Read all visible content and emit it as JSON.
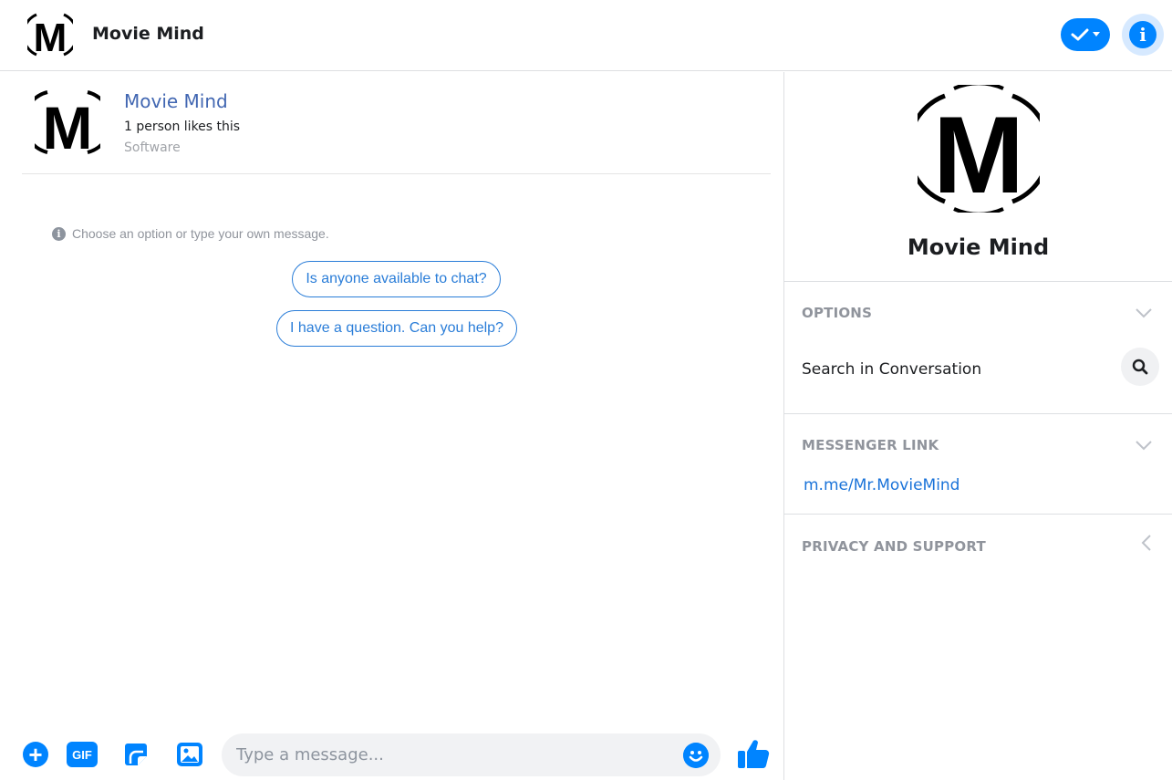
{
  "header": {
    "title": "Movie Mind"
  },
  "page": {
    "name": "Movie Mind",
    "likes": "1 person likes this",
    "category": "Software"
  },
  "chat": {
    "hint": "Choose an option or type your own message.",
    "quick_replies": [
      "Is anyone available to chat?",
      "I have a question. Can you help?"
    ]
  },
  "composer": {
    "placeholder": "Type a message...",
    "gif_label": "GIF"
  },
  "panel": {
    "title": "Movie Mind",
    "options_title": "OPTIONS",
    "search_label": "Search in Conversation",
    "messenger_link_title": "MESSENGER LINK",
    "messenger_link": "m.me/Mr.MovieMind",
    "privacy_title": "PRIVACY AND SUPPORT"
  },
  "logo_letter": "M",
  "colors": {
    "accent": "#0084ff",
    "link": "#1a73d9",
    "page_name": "#4267b2"
  }
}
